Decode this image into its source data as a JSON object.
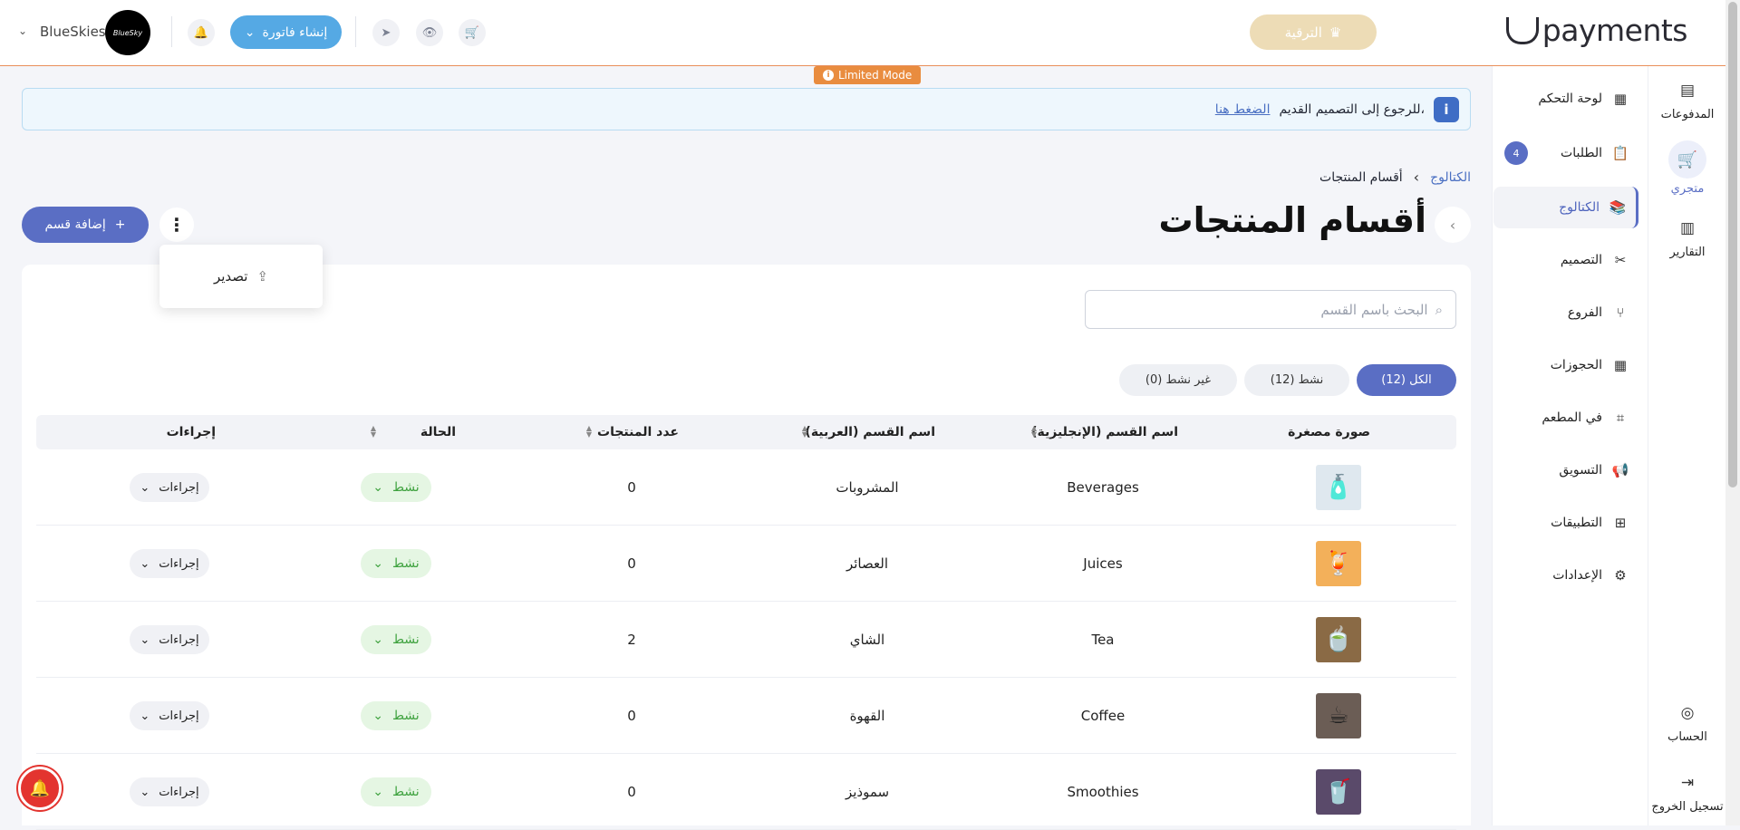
{
  "header": {
    "logo_text": "payments",
    "upgrade_label": "الترقية",
    "invoice_label": "إنشاء فاتورة",
    "avatar_text": "BlueSky",
    "user_name": "BlueSkies",
    "limited_mode": "Limited Mode"
  },
  "rail": {
    "payments": "المدفوعات",
    "store": "متجري",
    "reports": "التقارير",
    "account": "الحساب",
    "logout": "تسجيل الخروج"
  },
  "sidebar": {
    "items": [
      {
        "label": "لوحة التحكم",
        "icon": "dashboard-icon"
      },
      {
        "label": "الطلبات",
        "icon": "clipboard-icon",
        "badge": "4"
      },
      {
        "label": "الكتالوج",
        "icon": "catalog-icon"
      },
      {
        "label": "التصميم",
        "icon": "design-icon"
      },
      {
        "label": "الفروع",
        "icon": "branches-icon"
      },
      {
        "label": "الحجوزات",
        "icon": "calendar-icon"
      },
      {
        "label": "في المطعم",
        "icon": "qr-icon"
      },
      {
        "label": "التسويق",
        "icon": "megaphone-icon"
      },
      {
        "label": "التطبيقات",
        "icon": "apps-icon"
      },
      {
        "label": "الإعدادات",
        "icon": "settings-icon"
      }
    ]
  },
  "notice": {
    "text": "للرجوع إلى التصميم القديم،",
    "link": "الضغط هنا"
  },
  "breadcrumb": {
    "root": "الكتالوج",
    "current": "أقسام المنتجات"
  },
  "page": {
    "title": "أقسام المنتجات",
    "add_label": "إضافة قسم",
    "export_label": "تصدير"
  },
  "search": {
    "placeholder": "البحث باسم القسم"
  },
  "tabs": [
    {
      "label": "الكل (12)",
      "active": true
    },
    {
      "label": "نشط (12)",
      "active": false
    },
    {
      "label": "غير نشط (0)",
      "active": false
    }
  ],
  "table": {
    "headers": {
      "thumb": "صورة مصغرة",
      "name_en": "اسم القسم (الإنجليزية)",
      "name_ar": "اسم القسم (العربية)",
      "count": "عدد المنتجات",
      "status": "الحالة",
      "actions": "إجراءات"
    },
    "rows": [
      {
        "name_en": "Beverages",
        "name_ar": "المشروبات",
        "count": "0",
        "status": "نشط",
        "actions": "إجراءات"
      },
      {
        "name_en": "Juices",
        "name_ar": "العصائر",
        "count": "0",
        "status": "نشط",
        "actions": "إجراءات"
      },
      {
        "name_en": "Tea",
        "name_ar": "الشاي",
        "count": "2",
        "status": "نشط",
        "actions": "إجراءات"
      },
      {
        "name_en": "Coffee",
        "name_ar": "القهوة",
        "count": "0",
        "status": "نشط",
        "actions": "إجراءات"
      },
      {
        "name_en": "Smoothies",
        "name_ar": "سموذيز",
        "count": "0",
        "status": "نشط",
        "actions": "إجراءات"
      }
    ]
  },
  "colors": {
    "accent": "#5a6ec4",
    "invoice": "#55a9e4",
    "status_bg": "#e5f6e3",
    "status_fg": "#3fa23f",
    "limited": "#e98c3f"
  }
}
